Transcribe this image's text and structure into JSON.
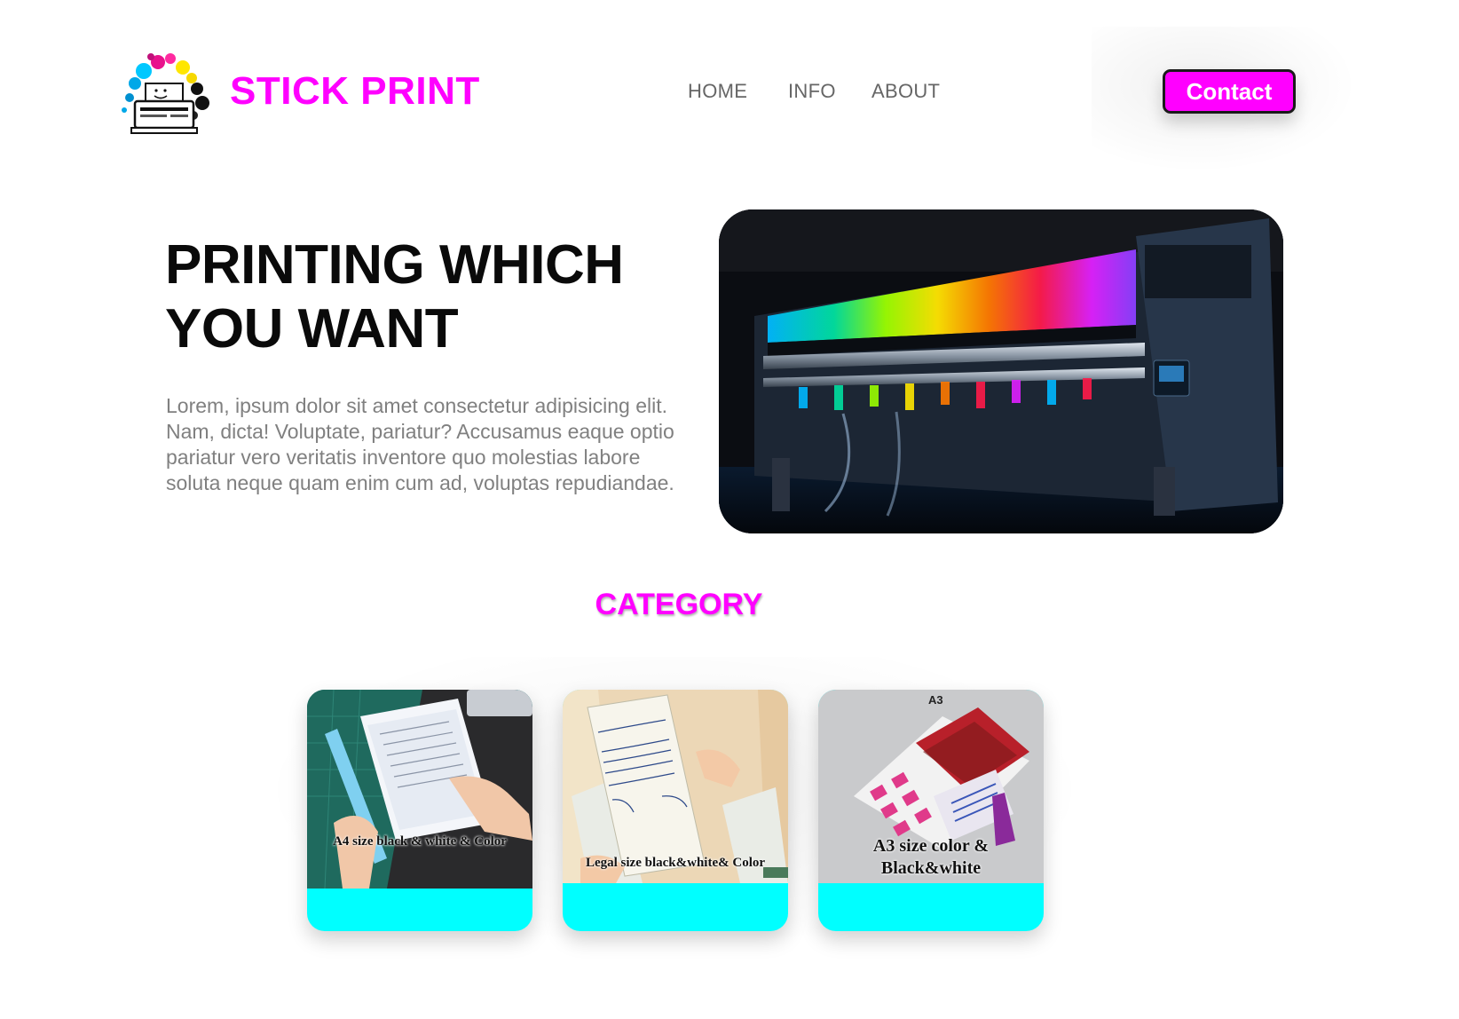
{
  "header": {
    "brand": "STICK PRINT",
    "logo_icon": "printer-splash-logo-icon",
    "nav": [
      "HOME",
      "INFO",
      "ABOUT"
    ],
    "contact_label": "Contact"
  },
  "hero": {
    "title": "PRINTING WHICH YOU WANT",
    "text": "Lorem, ipsum dolor sit amet consectetur adipisicing elit. Nam, dicta! Voluptate, pariatur? Accusamus eaque optio pariatur vero veritatis inventore quo molestias labore soluta neque quam enim cum ad, voluptas repudiandae.",
    "image": "large-format-color-printer-image"
  },
  "category": {
    "title": "CATEGORY",
    "cards": [
      {
        "caption": "A4 size black & white & Color",
        "image": "hands-holding-a4-paper-image"
      },
      {
        "caption": "Legal size black&white& Color",
        "image": "handwritten-legal-paper-image"
      },
      {
        "caption": "A3 size color & Black&white",
        "image": "a3-poster-prints-image",
        "top_label": "A3"
      }
    ]
  },
  "colors": {
    "accent": "#ff00ff",
    "card_footer": "#00ffff",
    "nav_text": "#666666",
    "body_text": "#808080"
  }
}
